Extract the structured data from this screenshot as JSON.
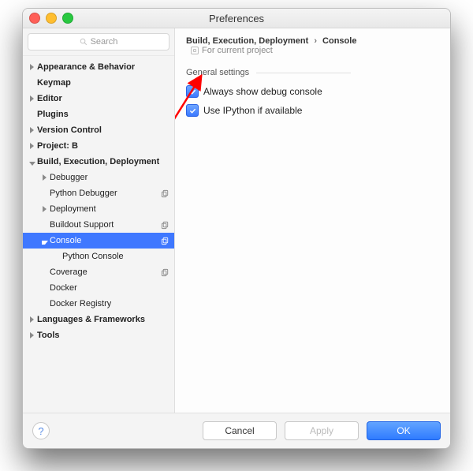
{
  "window": {
    "title": "Preferences"
  },
  "search": {
    "placeholder": "Search"
  },
  "tree": [
    {
      "id": "app",
      "label": "Appearance & Behavior",
      "depth": 0,
      "bold": true,
      "disclosure": "closed"
    },
    {
      "id": "km",
      "label": "Keymap",
      "depth": 0,
      "bold": true,
      "disclosure": "none"
    },
    {
      "id": "ed",
      "label": "Editor",
      "depth": 0,
      "bold": true,
      "disclosure": "closed"
    },
    {
      "id": "pl",
      "label": "Plugins",
      "depth": 0,
      "bold": true,
      "disclosure": "none"
    },
    {
      "id": "vc",
      "label": "Version Control",
      "depth": 0,
      "bold": true,
      "disclosure": "closed"
    },
    {
      "id": "pj",
      "label": "Project: B",
      "depth": 0,
      "bold": true,
      "disclosure": "closed"
    },
    {
      "id": "bed",
      "label": "Build, Execution, Deployment",
      "depth": 0,
      "bold": true,
      "disclosure": "open"
    },
    {
      "id": "dbg",
      "label": "Debugger",
      "depth": 1,
      "bold": false,
      "disclosure": "closed"
    },
    {
      "id": "pyd",
      "label": "Python Debugger",
      "depth": 1,
      "bold": false,
      "disclosure": "none",
      "copy": 1
    },
    {
      "id": "dep",
      "label": "Deployment",
      "depth": 1,
      "bold": false,
      "disclosure": "closed"
    },
    {
      "id": "bos",
      "label": "Buildout Support",
      "depth": 1,
      "bold": false,
      "disclosure": "none",
      "copy": 1
    },
    {
      "id": "con",
      "label": "Console",
      "depth": 1,
      "bold": false,
      "disclosure": "open",
      "copy": 1,
      "selected": 1
    },
    {
      "id": "pyc",
      "label": "Python Console",
      "depth": 2,
      "bold": false,
      "disclosure": "none"
    },
    {
      "id": "cov",
      "label": "Coverage",
      "depth": 1,
      "bold": false,
      "disclosure": "none",
      "copy": 1
    },
    {
      "id": "dk",
      "label": "Docker",
      "depth": 1,
      "bold": false,
      "disclosure": "none"
    },
    {
      "id": "dkr",
      "label": "Docker Registry",
      "depth": 1,
      "bold": false,
      "disclosure": "none"
    },
    {
      "id": "lf",
      "label": "Languages & Frameworks",
      "depth": 0,
      "bold": true,
      "disclosure": "closed"
    },
    {
      "id": "tl",
      "label": "Tools",
      "depth": 0,
      "bold": true,
      "disclosure": "closed"
    }
  ],
  "breadcrumb": {
    "parent": "Build, Execution, Deployment",
    "separator": "›",
    "current": "Console",
    "project_tag": "For current project"
  },
  "section": {
    "title": "General settings"
  },
  "checks": [
    {
      "key": "debug_console",
      "label": "Always show debug console",
      "checked": true
    },
    {
      "key": "ipython",
      "label": "Use IPython if available",
      "checked": true
    }
  ],
  "footer": {
    "help": "?",
    "cancel": "Cancel",
    "apply": "Apply",
    "ok": "OK"
  }
}
